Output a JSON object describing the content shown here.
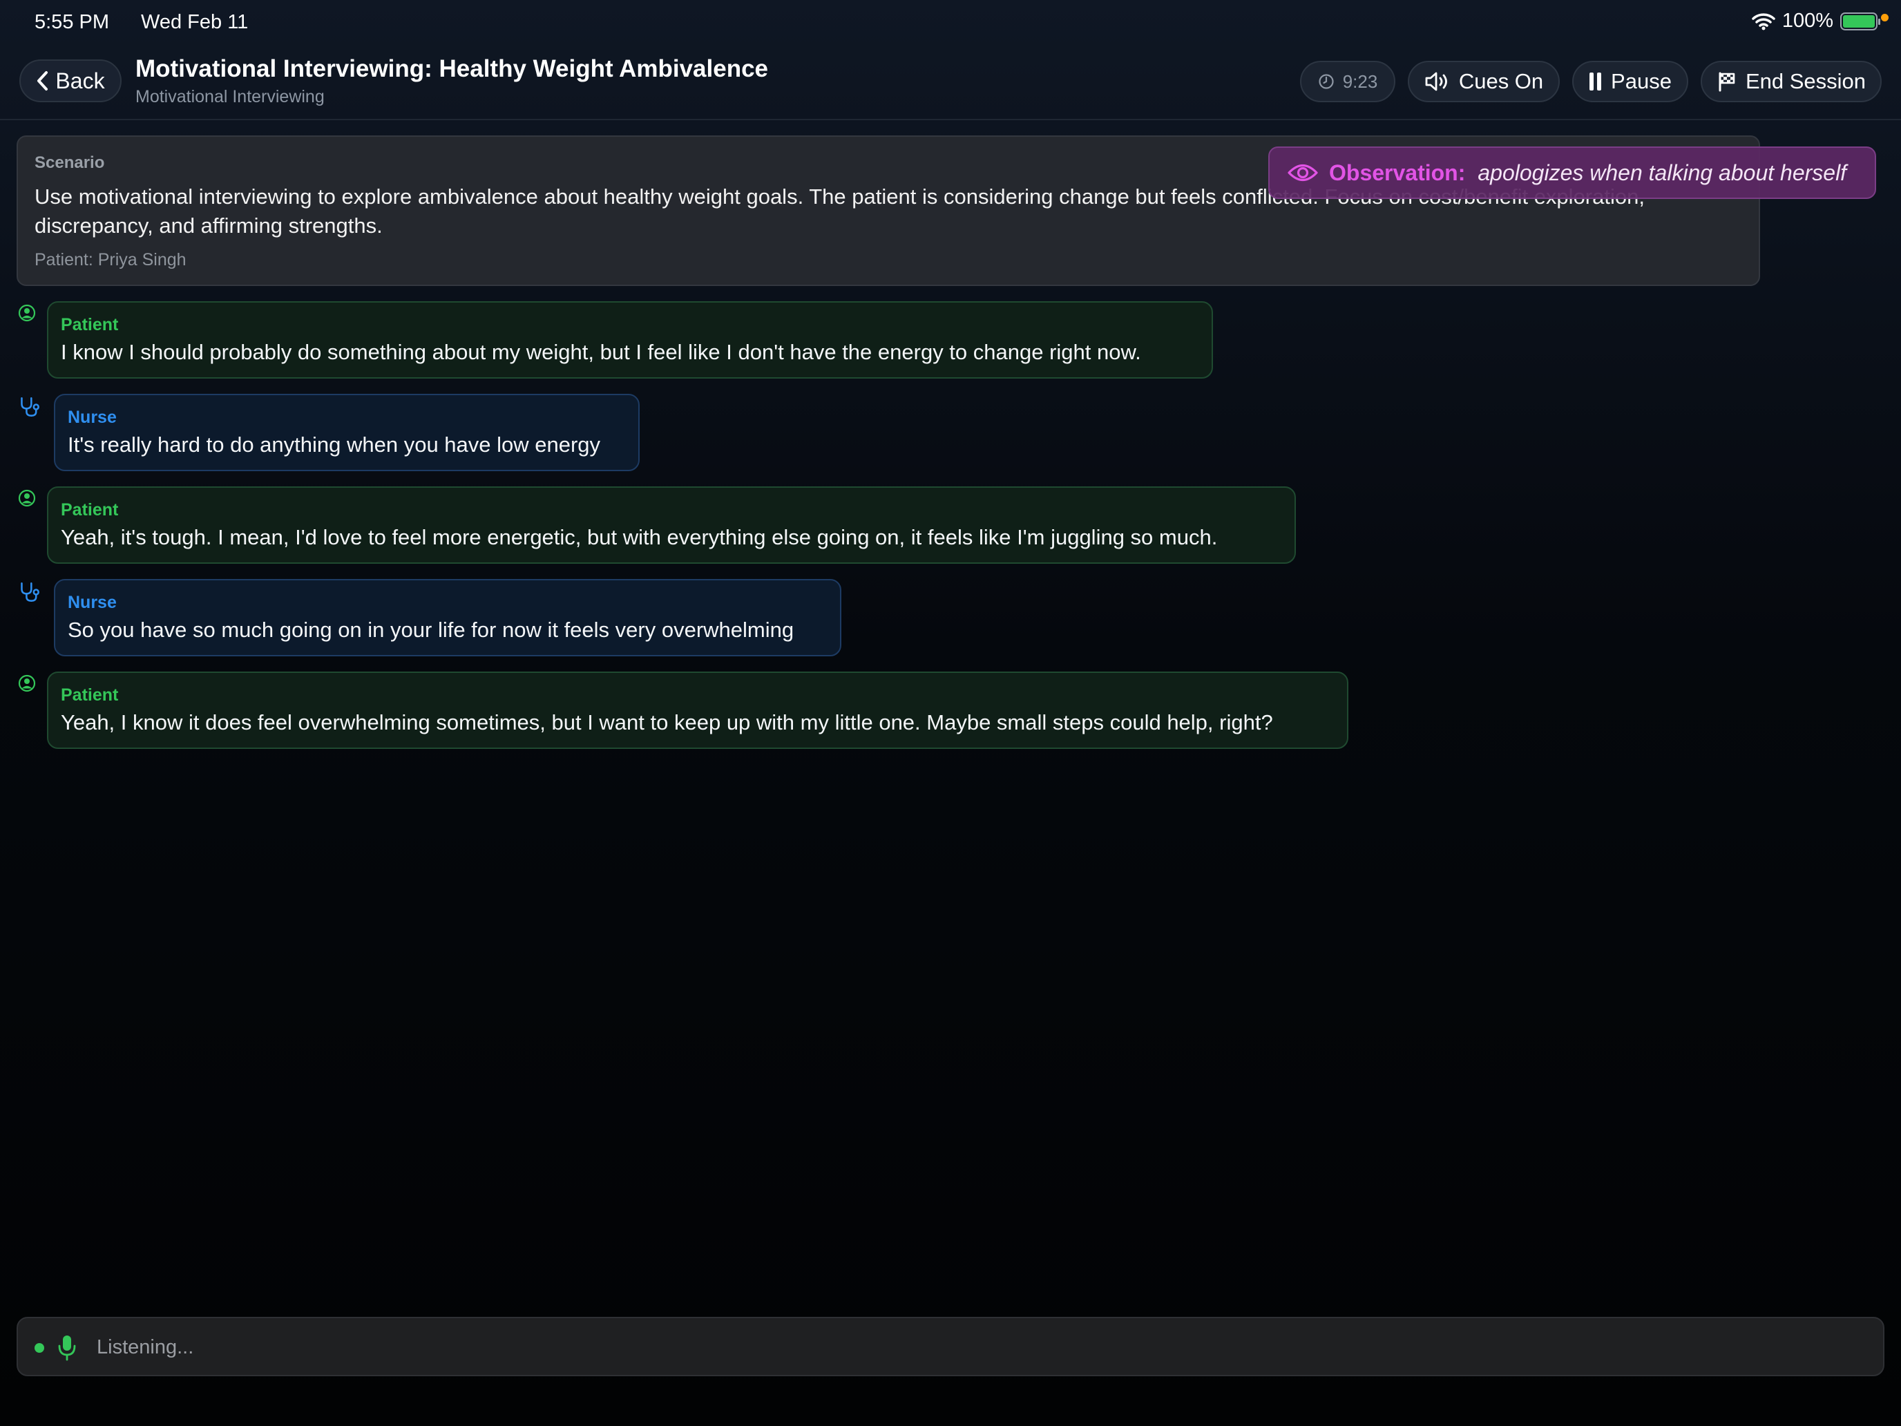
{
  "status_bar": {
    "time": "5:55 PM",
    "date": "Wed Feb 11",
    "battery": "100%"
  },
  "header": {
    "back_label": "Back",
    "title": "Motivational Interviewing: Healthy Weight Ambivalence",
    "subtitle": "Motivational Interviewing",
    "timer": "9:23",
    "cues_label": "Cues On",
    "pause_label": "Pause",
    "end_label": "End Session"
  },
  "scenario": {
    "label": "Scenario",
    "text": "Use motivational interviewing to explore ambivalence about healthy weight goals. The patient is considering change but feels conflicted. Focus on cost/benefit exploration, discrepancy, and affirming strengths.",
    "patient": "Patient: Priya Singh"
  },
  "observation": {
    "label": "Observation:",
    "text": "apologizes when talking about herself"
  },
  "messages": [
    {
      "role": "Patient",
      "text": "I know I should probably do something about my weight, but I feel like I don't have the energy to change right now."
    },
    {
      "role": "Nurse",
      "text": "It's really hard to do anything when you have low energy"
    },
    {
      "role": "Patient",
      "text": "Yeah, it's tough. I mean, I'd love to feel more energetic, but with everything else going on, it feels like I'm juggling so much."
    },
    {
      "role": "Nurse",
      "text": "So you have so much going on in your life for now it feels very overwhelming"
    },
    {
      "role": "Patient",
      "text": "Yeah, I know it does feel overwhelming sometimes, but I want to keep up with my little one. Maybe small steps could help, right?"
    }
  ],
  "input": {
    "status_text": "Listening..."
  },
  "colors": {
    "patient_accent": "#34c759",
    "nurse_accent": "#2f8ff0",
    "observation_accent": "#e254e6"
  }
}
